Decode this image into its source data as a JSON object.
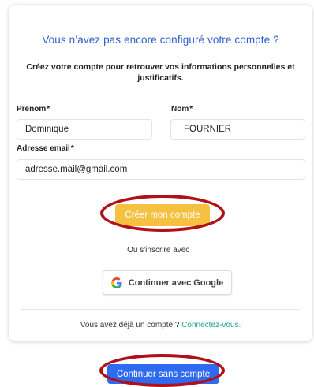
{
  "header": {
    "title": "Vous n’avez pas encore configuré votre compte ?",
    "subtitle": "Créez votre compte pour retrouver vos informations personnelles et justificatifs."
  },
  "form": {
    "first_name": {
      "label": "Prénom",
      "required_mark": "*",
      "value": "Dominique"
    },
    "last_name": {
      "label": "Nom",
      "required_mark": "*",
      "value": "FOURNIER"
    },
    "email": {
      "label": "Adresse email",
      "required_mark": "*",
      "value": "adresse.mail@gmail.com"
    }
  },
  "actions": {
    "create_label": "Créer mon compte",
    "or_text": "Ou s'inscrire avec :",
    "google_label": "Continuer avec Google",
    "skip_label": "Continuer sans compte"
  },
  "login": {
    "prompt": "Vous avez déjà un compte ? ",
    "link_label": "Connectez-vous."
  },
  "icons": {
    "google": "google-g-icon"
  },
  "colors": {
    "title": "#2f5fd0",
    "create_button": "#f6c040",
    "skip_button": "#2f6bf0",
    "link": "#1fa58c",
    "annotation_ring": "#b01018"
  }
}
